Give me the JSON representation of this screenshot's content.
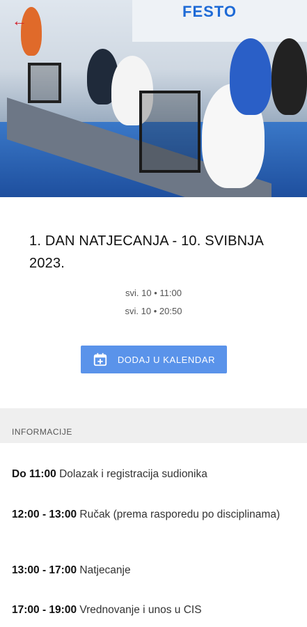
{
  "hero": {
    "banner_text": "FESTO"
  },
  "event": {
    "title": "1. DAN NATJECANJA - 10. SVIBNJA 2023.",
    "start": "svi. 10 • 11:00",
    "end": "svi. 10 • 20:50"
  },
  "calendar_button": {
    "label": "DODAJ U KALENDAR"
  },
  "info_section": {
    "header": "INFORMACIJE",
    "items": [
      {
        "time": "Do 11:00",
        "text": "Dolazak i registracija sudionika"
      },
      {
        "time": "12:00 - 13:00",
        "text": "Ručak (prema rasporedu po disciplinama)"
      },
      {
        "time": "13:00 - 17:00",
        "text": "Natjecanje"
      },
      {
        "time": "17:00 - 19:00",
        "text": "Vrednovanje i unos u CIS"
      }
    ]
  },
  "colors": {
    "accent_button": "#5a93ea",
    "back_arrow": "#d11f2a",
    "section_bg": "#efefef"
  },
  "icons": {
    "back": "arrow-left-icon",
    "calendar": "calendar-add-icon"
  }
}
